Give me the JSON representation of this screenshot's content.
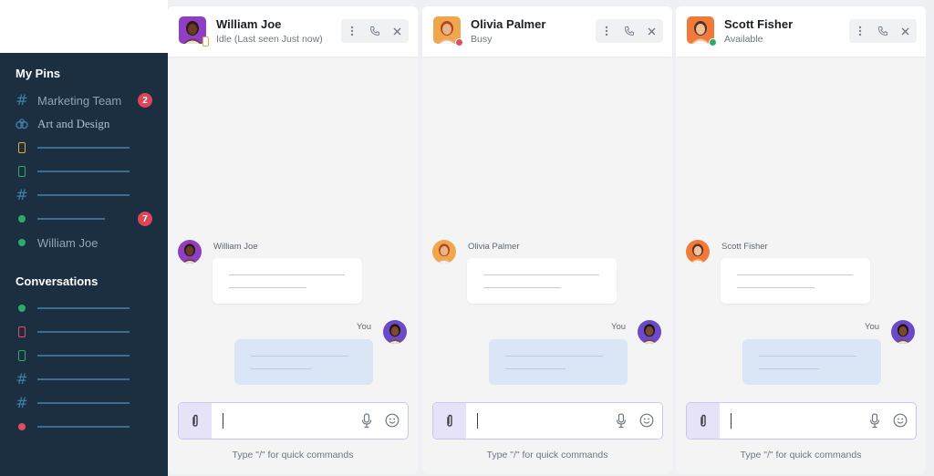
{
  "sidebar": {
    "pins_title": "My Pins",
    "conversations_title": "Conversations",
    "pins": [
      {
        "kind": "hash",
        "label": "Marketing Team",
        "badge": "2"
      },
      {
        "kind": "group",
        "label": "Art and Design"
      },
      {
        "kind": "phone",
        "color": "#e8a93b"
      },
      {
        "kind": "phone",
        "color": "#2cab6e"
      },
      {
        "kind": "hash"
      },
      {
        "kind": "dot",
        "color": "#2cab6e",
        "badge": "7"
      },
      {
        "kind": "dot",
        "color": "#2cab6e",
        "label": "William Joe"
      }
    ],
    "conversations": [
      {
        "kind": "dot",
        "color": "#2cab6e"
      },
      {
        "kind": "phone",
        "color": "#e04f5f"
      },
      {
        "kind": "phone",
        "color": "#2cab6e"
      },
      {
        "kind": "hash"
      },
      {
        "kind": "hash"
      },
      {
        "kind": "dot",
        "color": "#e04f5f"
      }
    ]
  },
  "panels": [
    {
      "name": "William Joe",
      "status": "Idle (Last seen Just now)",
      "indicator": "phone",
      "indicator_color": "#e8a93b",
      "avatar_bg": "#8f3fc4",
      "incoming_name": "William Joe",
      "you_label": "You",
      "composer_hint": "Type \"/\" for quick commands"
    },
    {
      "name": "Olivia Palmer",
      "status": "Busy",
      "indicator": "dot",
      "indicator_color": "#e04f5f",
      "avatar_bg": "#f0a64a",
      "incoming_name": "Olivia Palmer",
      "you_label": "You",
      "composer_hint": "Type \"/\" for quick commands"
    },
    {
      "name": "Scott Fisher",
      "status": "Available",
      "indicator": "dot",
      "indicator_color": "#2cab6e",
      "avatar_bg": "#f07a3a",
      "incoming_name": "Scott Fisher",
      "you_label": "You",
      "composer_hint": "Type \"/\" for quick commands"
    }
  ],
  "icons": {
    "more": "more-vertical-icon",
    "call": "phone-call-icon",
    "close": "close-icon",
    "attach": "paperclip-icon",
    "mic": "microphone-icon",
    "emoji": "emoji-icon"
  }
}
